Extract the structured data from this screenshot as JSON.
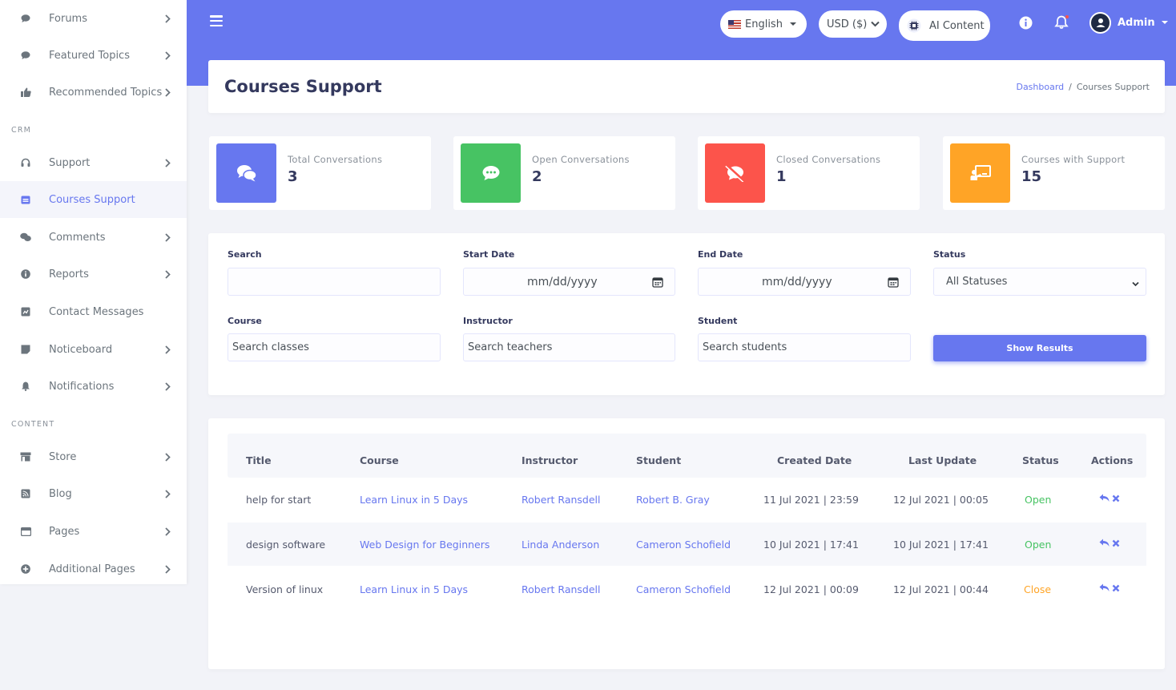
{
  "colors": {
    "primary": "#6777ef",
    "success": "#47c363",
    "danger": "#fc544b",
    "warning": "#ffa426"
  },
  "sidebar": {
    "items_top": [
      {
        "label": "Forums",
        "icon": "forum-icon",
        "chevron": true
      },
      {
        "label": "Featured Topics",
        "icon": "comment-icon",
        "chevron": true
      },
      {
        "label": "Recommended Topics",
        "icon": "thumbs-up-icon",
        "chevron": true
      }
    ],
    "crm_heading": "CRM",
    "items_crm": [
      {
        "label": "Support",
        "icon": "headset-icon",
        "chevron": true
      },
      {
        "label": "Courses Support",
        "icon": "envelope-icon",
        "chevron": false,
        "active": true
      },
      {
        "label": "Comments",
        "icon": "comments-icon",
        "chevron": true
      },
      {
        "label": "Reports",
        "icon": "info-circle-icon",
        "chevron": true
      },
      {
        "label": "Contact Messages",
        "icon": "message-icon",
        "chevron": false
      },
      {
        "label": "Noticeboard",
        "icon": "sticky-note-icon",
        "chevron": true
      },
      {
        "label": "Notifications",
        "icon": "bell-icon",
        "chevron": true
      }
    ],
    "content_heading": "CONTENT",
    "items_content": [
      {
        "label": "Store",
        "icon": "store-icon",
        "chevron": true
      },
      {
        "label": "Blog",
        "icon": "rss-icon",
        "chevron": true
      },
      {
        "label": "Pages",
        "icon": "window-icon",
        "chevron": true
      },
      {
        "label": "Additional Pages",
        "icon": "plus-circle-icon",
        "chevron": true
      }
    ]
  },
  "topbar": {
    "language": "English",
    "currency": "USD ($)",
    "ai_content": "AI Content",
    "user": "Admin"
  },
  "header": {
    "title": "Courses Support",
    "breadcrumb": [
      "Dashboard",
      "Courses Support"
    ]
  },
  "stats": [
    {
      "label": "Total Conversations",
      "value": "3",
      "color": "#6777ef",
      "icon": "comments-icon"
    },
    {
      "label": "Open Conversations",
      "value": "2",
      "color": "#47c363",
      "icon": "comment-dots-icon"
    },
    {
      "label": "Closed Conversations",
      "value": "1",
      "color": "#fc544b",
      "icon": "comment-slash-icon"
    },
    {
      "label": "Courses with Support",
      "value": "15",
      "color": "#ffa426",
      "icon": "chalkboard-teacher-icon"
    }
  ],
  "filters": {
    "search_label": "Search",
    "search_value": "",
    "start_date_label": "Start Date",
    "start_date_placeholder": "mm/dd/yyyy",
    "end_date_label": "End Date",
    "end_date_placeholder": "mm/dd/yyyy",
    "status_label": "Status",
    "status_value": "All Statuses",
    "course_label": "Course",
    "course_placeholder": "Search classes",
    "instructor_label": "Instructor",
    "instructor_placeholder": "Search teachers",
    "student_label": "Student",
    "student_placeholder": "Search students",
    "submit_label": "Show Results"
  },
  "table": {
    "columns": [
      "Title",
      "Course",
      "Instructor",
      "Student",
      "Created Date",
      "Last Update",
      "Status",
      "Actions"
    ],
    "rows": [
      {
        "title": "help for start",
        "course": "Learn Linux in 5 Days",
        "instructor": "Robert Ransdell",
        "student": "Robert B. Gray",
        "created": "11 Jul 2021 | 23:59",
        "updated": "12 Jul 2021 | 00:05",
        "status": "Open"
      },
      {
        "title": "design software",
        "course": "Web Design for Beginners",
        "instructor": "Linda Anderson",
        "student": "Cameron Schofield",
        "created": "10 Jul 2021 | 17:41",
        "updated": "10 Jul 2021 | 17:41",
        "status": "Open"
      },
      {
        "title": "Version of linux",
        "course": "Learn Linux in 5 Days",
        "instructor": "Robert Ransdell",
        "student": "Cameron Schofield",
        "created": "12 Jul 2021 | 00:09",
        "updated": "12 Jul 2021 | 00:44",
        "status": "Close"
      }
    ]
  }
}
